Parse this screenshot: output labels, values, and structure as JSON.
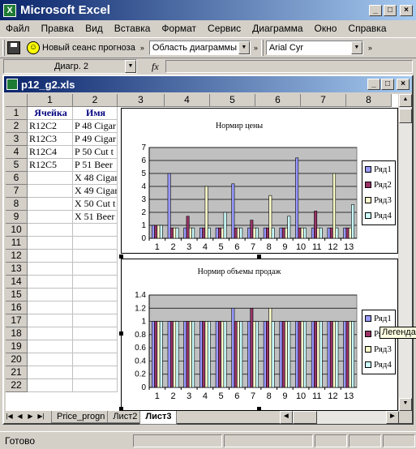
{
  "app": {
    "title": "Microsoft Excel"
  },
  "menu": [
    "Файл",
    "Правка",
    "Вид",
    "Вставка",
    "Формат",
    "Сервис",
    "Диаграмма",
    "Окно",
    "Справка"
  ],
  "toolbar": {
    "forecast_label": "Новый сеанс прогноза",
    "chart_area": "Область диаграммы",
    "font": "Arial Cyr"
  },
  "formula": {
    "name_box": "Диагр. 2",
    "fx": "fx"
  },
  "workbook": {
    "title": "p12_g2.xls"
  },
  "grid": {
    "columns": [
      "1",
      "2",
      "3",
      "4",
      "5",
      "6",
      "7",
      "8"
    ],
    "rows": [
      "1",
      "2",
      "3",
      "4",
      "5",
      "6",
      "7",
      "8",
      "9",
      "10",
      "11",
      "12",
      "13",
      "14",
      "15",
      "16",
      "17",
      "18",
      "19",
      "20",
      "21",
      "22"
    ],
    "header_row": [
      "Ячейка",
      "Имя"
    ],
    "col1": [
      "R12C2",
      "R12C3",
      "R12C4",
      "R12C5"
    ],
    "col2": [
      "P 48 Cigar",
      "P 49 Cigar",
      "P 50 Cut t",
      "P 51 Beer",
      "X 48 Cigar",
      "X 49 Cigar",
      "X 50 Cut t",
      "X 51 Beer"
    ]
  },
  "sheets": {
    "tabs": [
      "Price_progn",
      "Лист2",
      "Лист3"
    ],
    "active": "Лист3"
  },
  "status": {
    "text": "Готово"
  },
  "tooltip": "Легенда",
  "colors": {
    "s1": "#9999ff",
    "s2": "#993366",
    "s3": "#ffffcc",
    "s4": "#ccffff",
    "plot_bg": "#c0c0c0"
  },
  "chart_data": [
    {
      "type": "bar",
      "title": "Нормир цены",
      "categories": [
        "1",
        "2",
        "3",
        "4",
        "5",
        "6",
        "7",
        "8",
        "9",
        "10",
        "11",
        "12",
        "13"
      ],
      "ylim": [
        0,
        7
      ],
      "yticks": [
        "0",
        "1",
        "2",
        "3",
        "4",
        "5",
        "6",
        "7"
      ],
      "legend_position": "right",
      "series": [
        {
          "name": "Ряд1",
          "values": [
            1,
            5,
            0.8,
            0.8,
            0.8,
            4.2,
            0.8,
            0.8,
            0.8,
            6.2,
            0.8,
            0.8,
            0.8
          ]
        },
        {
          "name": "Ряд2",
          "values": [
            1,
            0.8,
            1.7,
            0.8,
            0.8,
            0.8,
            1.4,
            0.8,
            0.8,
            0.8,
            2.1,
            0.8,
            0.8
          ]
        },
        {
          "name": "Ряд3",
          "values": [
            1,
            0.8,
            0.8,
            4,
            0.8,
            0.8,
            0.8,
            3.3,
            0.8,
            0.8,
            0.8,
            5,
            0.8
          ]
        },
        {
          "name": "Ряд4",
          "values": [
            1,
            0.8,
            0.8,
            0.8,
            2,
            0.8,
            0.8,
            0.8,
            1.7,
            0.8,
            0.8,
            0.8,
            2.6
          ]
        }
      ]
    },
    {
      "type": "bar",
      "title": "Нормир объемы продаж",
      "categories": [
        "1",
        "2",
        "3",
        "4",
        "5",
        "6",
        "7",
        "8",
        "9",
        "10",
        "11",
        "12",
        "13"
      ],
      "ylim": [
        0,
        1.4
      ],
      "yticks": [
        "0",
        "0.2",
        "0.4",
        "0.6",
        "0.8",
        "1",
        "1.2",
        "1.4"
      ],
      "legend_position": "right",
      "series": [
        {
          "name": "Ряд1",
          "values": [
            1,
            1,
            1,
            1,
            1,
            1.2,
            1,
            1,
            1,
            1,
            1,
            1,
            1
          ]
        },
        {
          "name": "Ряд2",
          "values": [
            1,
            1,
            1,
            1,
            1,
            1,
            1.2,
            1,
            1,
            1,
            1,
            1,
            1
          ]
        },
        {
          "name": "Ряд3",
          "values": [
            1,
            1,
            1,
            1,
            1,
            1,
            1,
            1.2,
            1,
            1,
            1,
            1,
            1
          ]
        },
        {
          "name": "Ряд4",
          "values": [
            1,
            1,
            1,
            1,
            1,
            1,
            1,
            1,
            1,
            1,
            1,
            1,
            1
          ]
        }
      ]
    }
  ]
}
